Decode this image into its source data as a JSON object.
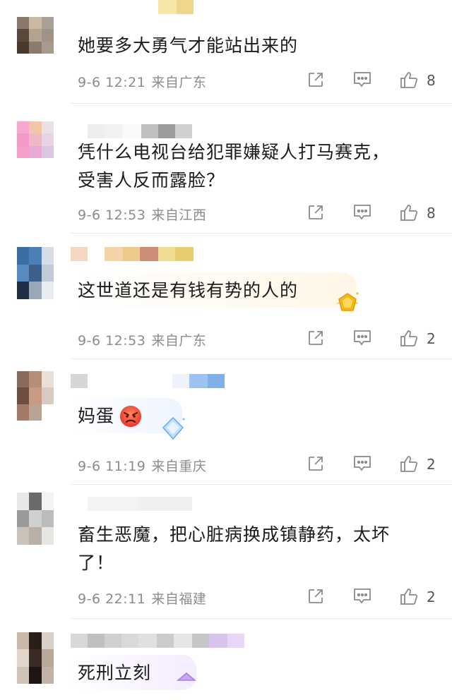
{
  "comments": [
    {
      "text_lines": [
        "她要多大勇气才能站出来的"
      ],
      "date": "9-6 12:21",
      "location": "来自广东",
      "likes": "8"
    },
    {
      "text_lines": [
        "凭什么电视台给犯罪嫌疑人打马赛克，",
        "受害人反而露脸？"
      ],
      "date": "9-6 12:53",
      "location": "来自江西",
      "likes": "8"
    },
    {
      "text_lines": [
        "这世道还是有钱有势的人的"
      ],
      "date": "9-6 12:53",
      "location": "来自广东",
      "likes": "2"
    },
    {
      "text_lines": [
        "妈蛋"
      ],
      "date": "9-6 11:19",
      "location": "来自重庆",
      "likes": "2"
    },
    {
      "text_lines": [
        "畜生恶魔，把心脏病换成镇静药，太坏",
        "了！"
      ],
      "date": "9-6 22:11",
      "location": "来自福建",
      "likes": "2"
    },
    {
      "text_lines": [
        "死刑立刻"
      ]
    }
  ],
  "icons": {
    "share": "share-icon",
    "comment": "comment-icon",
    "like": "thumbs-up-icon",
    "angry_emoji": "angry-face-icon"
  },
  "colors": {
    "meta_text": "#8c8c8c",
    "icon": "#8a8a8a",
    "bubble_accent": "#fff6e6"
  }
}
